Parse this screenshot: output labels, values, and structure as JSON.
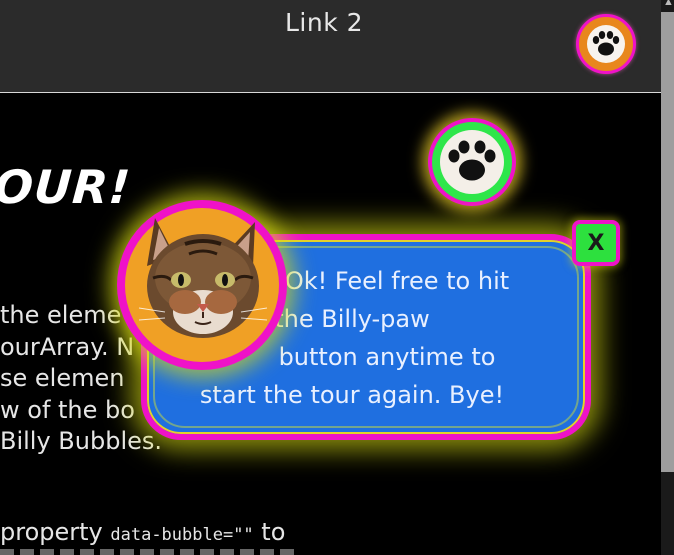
{
  "header": {
    "nav_link": "Link 2"
  },
  "page": {
    "heading": "OUR!",
    "body_lines": [
      "the eleme",
      "ourArray. N",
      "se elemen",
      "w of the bo",
      "Billy Bubbles."
    ],
    "property_prefix": "property ",
    "property_code": "data-bubble=\"\"",
    "property_suffix": " to"
  },
  "bubble": {
    "lines": [
      "Ok! Feel free to hit",
      "the Billy-paw",
      "button anytime to",
      "start the tour again. Bye!"
    ],
    "close_label": "X"
  },
  "colors": {
    "header_bg": "#2b2b2b",
    "page_bg": "#000000",
    "bubble_bg": "#1f6fe0",
    "bubble_border": "#ef12c8",
    "glow": "#d7dc14",
    "close_bg": "#2de03e",
    "paw_header_bg": "#e8871d",
    "paw_float_bg": "#2ee64a",
    "avatar_ring": "#f0a025"
  },
  "icons": {
    "header_paw": "paw-icon",
    "float_paw": "paw-icon",
    "avatar": "cat-face-avatar"
  }
}
